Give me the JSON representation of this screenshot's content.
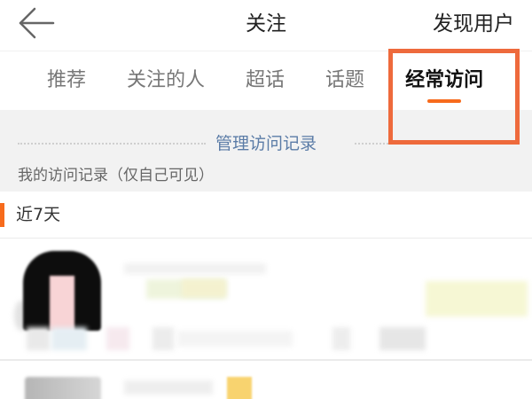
{
  "colors": {
    "accent": "#f76b1c",
    "annotation": "#ee6a3c",
    "link": "#5b7ca7",
    "panel_background": "#f2f2f2"
  },
  "header": {
    "back_icon": "back-arrow-icon",
    "title": "关注",
    "discover_users_label": "发现用户"
  },
  "tabs": [
    {
      "label": "推荐",
      "active": false
    },
    {
      "label": "关注的人",
      "active": false
    },
    {
      "label": "超话",
      "active": false
    },
    {
      "label": "话题",
      "active": false
    },
    {
      "label": "经常访问",
      "active": true
    }
  ],
  "visit_records": {
    "manage_label": "管理访问记录",
    "privacy_caption": "我的访问记录（仅自己可见）"
  },
  "recent_section": {
    "title": "近7天"
  }
}
